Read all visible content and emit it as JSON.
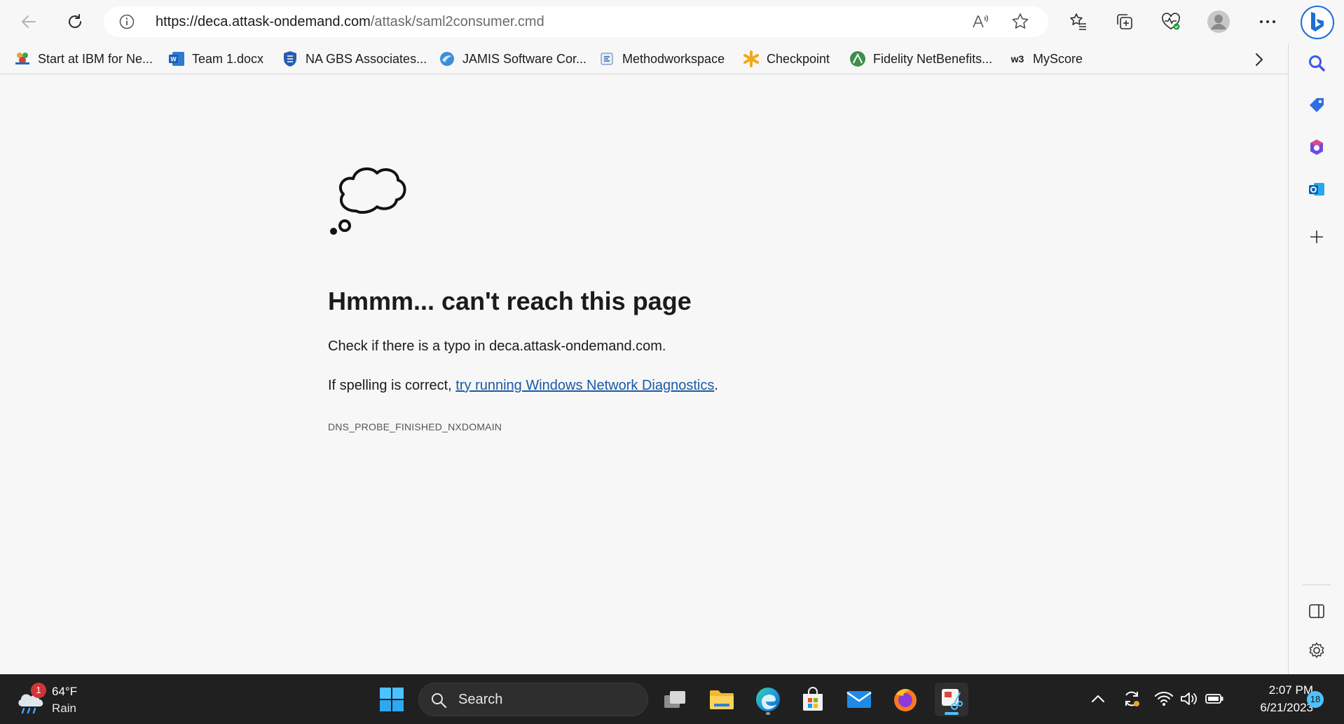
{
  "browser": {
    "url_host": "https://deca.attask-ondemand.com",
    "url_path": "/attask/saml2consumer.cmd"
  },
  "favorites": [
    {
      "label": "Start at IBM for Ne...",
      "icon": "ibm-bee-icon"
    },
    {
      "label": "Team 1.docx",
      "icon": "word-icon"
    },
    {
      "label": "NA GBS Associates...",
      "icon": "shield-icon"
    },
    {
      "label": "JAMIS Software Cor...",
      "icon": "jamis-icon"
    },
    {
      "label": "Methodworkspace",
      "icon": "method-icon"
    },
    {
      "label": "Checkpoint",
      "icon": "asterisk-icon"
    },
    {
      "label": "Fidelity NetBenefits...",
      "icon": "fidelity-icon"
    },
    {
      "label": "MyScore",
      "icon": "w3-icon",
      "badge": "w3"
    }
  ],
  "error_page": {
    "title": "Hmmm... can't reach this page",
    "line1": "Check if there is a typo in deca.attask-ondemand.com.",
    "line2_prefix": "If spelling is correct, ",
    "line2_link": "try running Windows Network Diagnostics",
    "line2_suffix": ".",
    "code": "DNS_PROBE_FINISHED_NXDOMAIN"
  },
  "taskbar": {
    "weather": {
      "temp": "64°F",
      "condition": "Rain",
      "badge": "1"
    },
    "search_label": "Search",
    "clock_time": "2:07 PM",
    "clock_date": "6/21/2023",
    "notification_count": "18"
  },
  "colors": {
    "link": "#1a5aa6",
    "taskbar_bg": "#202020",
    "accent": "#4cc2ff"
  }
}
